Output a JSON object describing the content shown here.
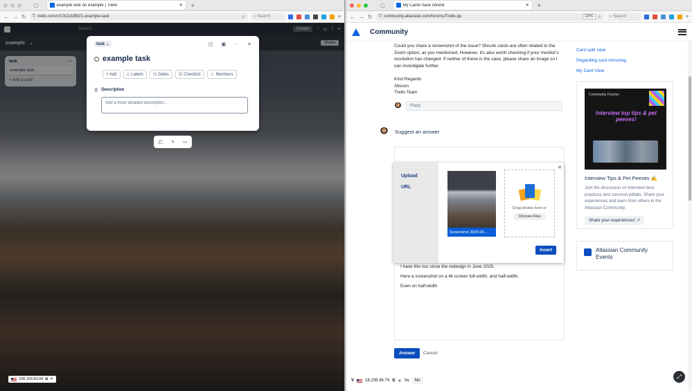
{
  "left_window": {
    "tab_title": "example task on example | Trello",
    "url": "trello.com/c/UX2zd2B0/1-example-task",
    "search_placeholder": "Search",
    "trello_search": "Search",
    "create_label": "Create",
    "board_name": "example",
    "share_label": "Share",
    "list_title": "task",
    "list_card": "example task",
    "add_card": "+ Add a card",
    "modal": {
      "list_select": "task ⌄",
      "title": "example task",
      "actions": [
        "+ Add",
        "Labels",
        "Dates",
        "Checklist",
        "Members"
      ],
      "description_label": "Description",
      "description_placeholder": "Add a more detailed description..."
    },
    "ip_badge": "108.156.60.94"
  },
  "right_window": {
    "tab_title": "My Cards have shrunk",
    "url": "community.atlassian.com/forums/Trello-qu",
    "zoom": "120%",
    "search_placeholder": "Search",
    "site_title": "Community",
    "reply_text": "Could you share a screenshot of the issue? Shrunk cards are often related to the Zoom option, as you mentioned. However, it's also worth checking if your monitor's resolution has changed. If neither of these is the case, please share an image so I can investigate further.",
    "sign_lines": [
      "Kind Regards",
      "Alisson",
      "Trello Team"
    ],
    "reply_placeholder": "Reply",
    "suggest_label": "Suggest an answer",
    "upload_tabs": [
      "Upload",
      "URL"
    ],
    "thumb_caption": "Screenshot 2025-06-...",
    "drag_text": "Drag photos here or",
    "choose_files": "Choose Files",
    "insert_label": "Insert",
    "editor_lines": [
      "I have this too since the redesign in June 2025.",
      "Here a screenshot on a 4k screen full-width, and half-width.",
      "Even on half-width"
    ],
    "answer_label": "Answer",
    "cancel_label": "Cancel",
    "side_links": [
      "Card split view",
      "Regarding card mirroring.",
      "My Card View"
    ],
    "promo": {
      "tag": "Community Forums",
      "headline": "Interview top tips & pet peeves!",
      "title": "Interview Tips & Pet Peeves ✍️",
      "text": "Join the discussion on interview best practices and common pitfalls. Share your experiences and learn from others in the Atlassian Community.",
      "button": "Share your experiences! ↗"
    },
    "events_title": "Atlassian Community Events",
    "status_ip": "18.239.36.74",
    "status_yes": "'es",
    "status_no": "No"
  }
}
